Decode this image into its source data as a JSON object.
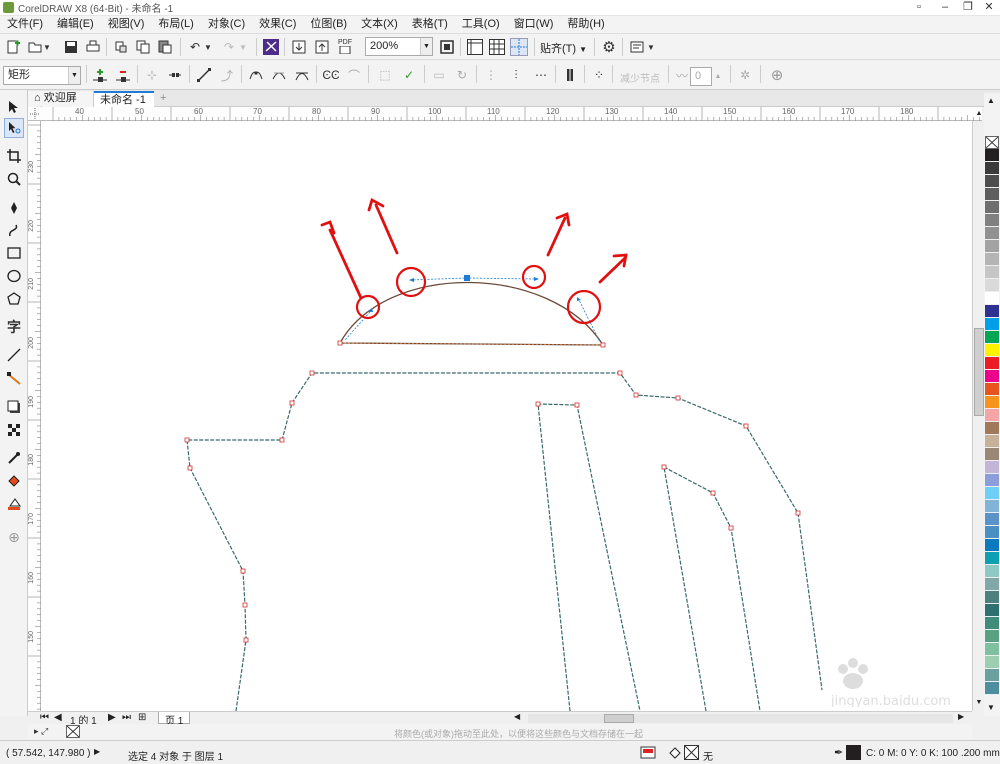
{
  "window": {
    "title": "CorelDRAW X8 (64-Bit) - 未命名 -1"
  },
  "menu": [
    "文件(F)",
    "编辑(E)",
    "视图(V)",
    "布局(L)",
    "对象(C)",
    "效果(C)",
    "位图(B)",
    "文本(X)",
    "表格(T)",
    "工具(O)",
    "窗口(W)",
    "帮助(H)"
  ],
  "toolbar": {
    "zoom": "200%",
    "snap_label": "贴齐(T)",
    "pdf_label": "PDF"
  },
  "propbar": {
    "shape_type": "矩形",
    "reduce_nodes": "减少节点",
    "smooth_value": "0"
  },
  "tabs": [
    {
      "label": "欢迎屏幕"
    },
    {
      "label": "未命名 -1"
    }
  ],
  "ruler": {
    "h_ticks": [
      "40",
      "50",
      "60",
      "70",
      "80",
      "90",
      "100",
      "110",
      "120",
      "130",
      "140",
      "150",
      "160",
      "170",
      "180"
    ],
    "v_ticks": [
      "230",
      "220",
      "210",
      "200",
      "190",
      "180",
      "170",
      "160",
      "150"
    ]
  },
  "pagebar": {
    "counter": "1 的 1",
    "page_tab": "页 1"
  },
  "hint": "将颜色(或对象)拖动至此处，以便将这些颜色与文档存储在一起",
  "status": {
    "coords": "( 57.542, 147.980 )",
    "selection": "选定 4 对象 于 图层 1",
    "fill_none": "无",
    "outline": "C: 0 M: 0 Y: 0 K: 100  .200 mm"
  },
  "palette": [
    "#231f20",
    "#3b3b3b",
    "#4d4d4d",
    "#5e5e5e",
    "#6f6f6f",
    "#808080",
    "#919191",
    "#a3a3a3",
    "#b4b4b4",
    "#c6c6c6",
    "#d9d9d9",
    "#ffffff",
    "#2e3192",
    "#00a0e9",
    "#00a651",
    "#fff200",
    "#ed1c24",
    "#ec008c",
    "#e8541e",
    "#f7941d",
    "#f4a6a6",
    "#a0785a",
    "#c7b299",
    "#998675",
    "#c2b5d8",
    "#8c9ddc",
    "#6dcff6",
    "#82b4d8",
    "#5a93c8",
    "#4a90c2",
    "#0a7abf",
    "#0f9fb3",
    "#8ec9c4",
    "#80a8a8",
    "#4e7f7f",
    "#2e6f6f",
    "#3f8c7b",
    "#5aa184",
    "#7fc0a0",
    "#9ccfb0",
    "#6aa0a0",
    "#4d8fa0"
  ],
  "colors": {
    "accent": "#1e7bd6",
    "annotation": "#e01010",
    "path": "#3a6a6a"
  }
}
